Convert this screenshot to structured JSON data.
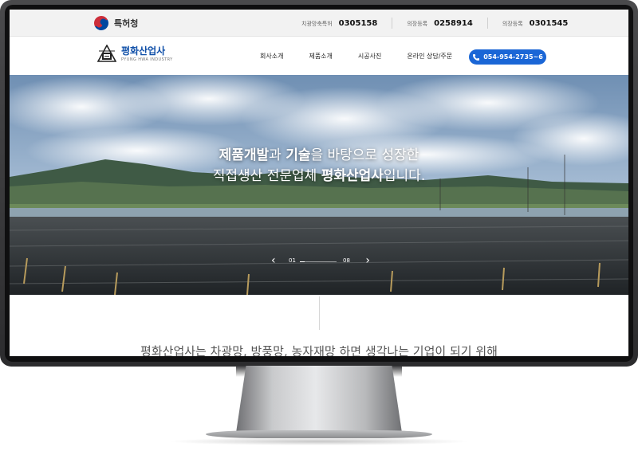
{
  "topbar": {
    "org_label": "특허청",
    "registrations": [
      {
        "label": "치광망축특허",
        "number": "0305158"
      },
      {
        "label": "의장등록",
        "number": "0258914"
      },
      {
        "label": "의장등록",
        "number": "0301545"
      }
    ]
  },
  "header": {
    "logo_name": "평화산업사",
    "logo_sub": "PYUNG HWA INDUSTRY",
    "nav": [
      "회사소개",
      "제품소개",
      "시공사진",
      "온라인 상담/주문"
    ],
    "phone": "054-954-2735~6"
  },
  "hero": {
    "line1_bold1": "제품개발",
    "line1_mid": "과 ",
    "line1_bold2": "기술",
    "line1_rest": "을 바탕으로 성장한",
    "line2_start": "직접생산 전문업체 ",
    "line2_bold": "평화산업사",
    "line2_end": "입니다.",
    "slide_current": "01",
    "slide_total": "08",
    "slide_progress": 0.125
  },
  "intro_text": "평화산업사는 차광망, 방풍망, 농자재망 하면 생각나는 기업이 되기 위해",
  "colors": {
    "brand_blue": "#0f4fa8",
    "phone_button": "#1a66d6"
  }
}
